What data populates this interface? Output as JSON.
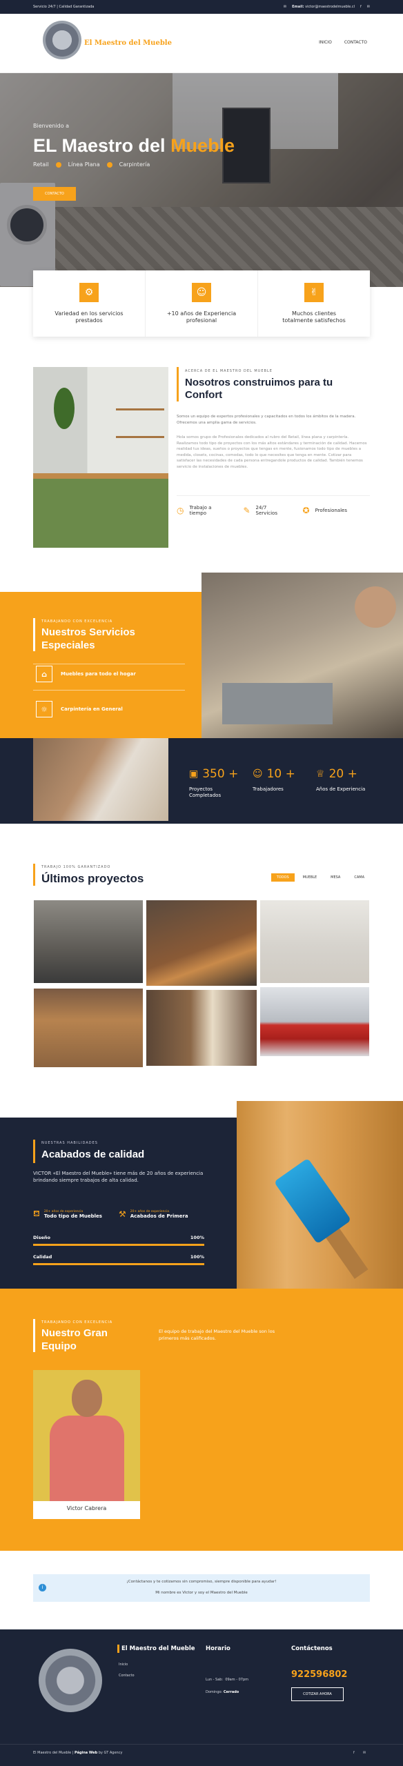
{
  "topbar": {
    "left": "Servicio 24/7 | Calidad Garantizada",
    "email_label": "Email:",
    "email": "victor@maestrodelmueble.cl",
    "social": [
      "facebook-icon",
      "mail-icon"
    ]
  },
  "header": {
    "logo_text": "El Maestro del Mueble",
    "nav": [
      "INICIO",
      "CONTACTO"
    ]
  },
  "hero": {
    "sub": "Bienvenido a",
    "title_a": "EL Maestro del ",
    "title_b": "Mueble",
    "tags": [
      "Retail",
      "Línea Plana",
      "Carpintería"
    ],
    "cta": "CONTACTO"
  },
  "features": [
    {
      "icon": "gear-icon",
      "text": "Variedad en los servicios prestados"
    },
    {
      "icon": "user-icon",
      "text": "+10 años de Experiencia profesional"
    },
    {
      "icon": "thumbs-up-icon",
      "text": "Muchos clientes totalmente satisfechos"
    }
  ],
  "about": {
    "kicker": "ACERCA DE EL MAESTRO DEL MUEBLE",
    "title": "Nosotros construimos para tu Confort",
    "intro": "Somos un equipo de expertos profesionales y capacitados en todos los ámbitos de la madera. Ofrecemos una amplia gama de servicios.",
    "body": "Hola somos grupo de Profesionales dedicados al rubro del Retail, línea plana y carpintería. Realizamos todo tipo de proyectos con los más altos estándares y terminación de calidad. Hacemos realidad tus ideas, sueños o proyectos que tengas en mente, fusionamos todo tipo de muebles a medida, closets, cocinas, comodas, todo lo que necesites que tenga en mente. Cotizar para satisfacer las necesidades de cada persona entregandole productos de calidad. También tenemos servicio de instalaciones de muebles.",
    "items": [
      {
        "icon": "clock-icon",
        "label": "Trabajo a tiempo"
      },
      {
        "icon": "tools-icon",
        "label": "24/7 Servicios"
      },
      {
        "icon": "award-icon",
        "label": "Profesionales"
      }
    ]
  },
  "services": {
    "kicker": "TRABAJANDO CON EXCELENCIA",
    "title": "Nuestros Servicios Especiales",
    "items": [
      {
        "icon": "home-icon",
        "label": "Muebles para todo el hogar"
      },
      {
        "icon": "bulb-icon",
        "label": "Carpintería en General"
      }
    ]
  },
  "stats": [
    {
      "icon": "briefcase-icon",
      "value": "350 +",
      "label": "Proyectos Completados"
    },
    {
      "icon": "users-icon",
      "value": "10 +",
      "label": "Trabajadores"
    },
    {
      "icon": "trophy-icon",
      "value": "20 +",
      "label": "Años de Experiencia"
    }
  ],
  "projects": {
    "kicker": "TRABAJO 100% GARANTIZADO",
    "title": "Últimos proyectos",
    "filters": [
      "TODOS",
      "MUEBLE",
      "MESA",
      "CAMA"
    ]
  },
  "quality": {
    "kicker": "NUESTRAS HABILIDADES",
    "title": "Acabados de calidad",
    "body": "VICTOR «El Maestro del Mueble» tiene más de 20 años de experiencia brindando siempre trabajos de alta calidad.",
    "badges": [
      {
        "small": "20+ años de experiencia",
        "label": "Todo tipo de Muebles"
      },
      {
        "small": "20+ años de experiencia",
        "label": "Acabados de Primera"
      }
    ],
    "bars": [
      {
        "label": "Diseño",
        "value": 100,
        "text": "100%"
      },
      {
        "label": "Calidad",
        "value": 100,
        "text": "100%"
      }
    ]
  },
  "team": {
    "kicker": "TRABAJANDO CON EXCELENCIA",
    "title": "Nuestro Gran Equipo",
    "desc": "El equipo de trabajo del Maestro del Mueble son los primeros más calificados.",
    "member": "Victor Cabrera"
  },
  "notice": {
    "line1": "¡Contáctanos y te cotizamos sin compromiso, siempre disponible para ayudar!",
    "line2": "Mi nombre es Victor y soy el Maestro del Mueble"
  },
  "footer": {
    "brand": "El Maestro del Mueble",
    "links": [
      "Inicio",
      "Contacto"
    ],
    "hours_title": "Horario",
    "hours": [
      {
        "day": "Lun - Sab:",
        "time": "09am - 07pm"
      },
      {
        "day": "Domingo:",
        "time": "Cerrado"
      }
    ],
    "contact_title": "Contáctenos",
    "phone": "922596802",
    "cta": "COTIZAR AHORA",
    "copyright_a": "El Maestro del Mueble | ",
    "copyright_b": "Página Web",
    "copyright_c": " by GT Agency"
  },
  "colors": {
    "accent": "#f7a21b",
    "dark": "#1c2437"
  }
}
